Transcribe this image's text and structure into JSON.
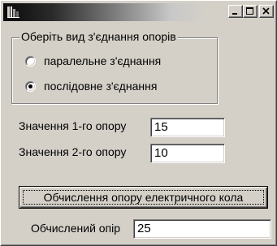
{
  "window": {
    "titlebar": {
      "minimize_glyph": "_",
      "maximize_glyph": "□",
      "close_glyph": "×"
    }
  },
  "connection_group": {
    "legend": "Оберіть вид з'єднання опорів",
    "options": [
      {
        "label": "паралельне з'єднання",
        "selected": false
      },
      {
        "label": "послідовне з'єднання",
        "selected": true
      }
    ]
  },
  "inputs": {
    "r1_label": "Значення 1-го опору",
    "r1_value": "15",
    "r2_label": "Значення 2-го опору",
    "r2_value": "10"
  },
  "calculate_button": {
    "label": "Обчислення опору електричного кола"
  },
  "result": {
    "label": "Обчислений опір",
    "value": "25"
  },
  "colors": {
    "face": "#d4d0c8",
    "field_bg": "#ffffff",
    "shadow": "#808080"
  }
}
